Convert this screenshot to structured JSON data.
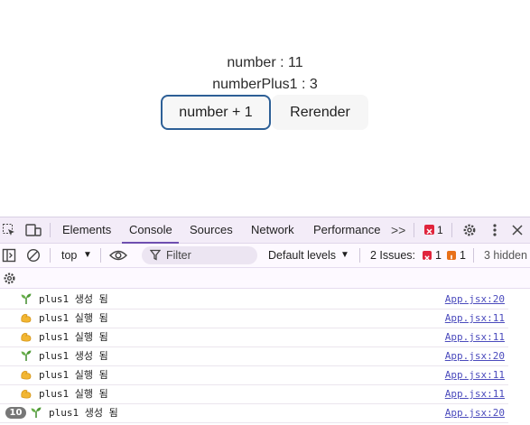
{
  "app": {
    "number_text": "number : 11",
    "numberplus1_text": "numberPlus1 : 3",
    "plus_button": "number + 1",
    "rerender_button": "Rerender"
  },
  "devtools": {
    "tabs": [
      "Elements",
      "Console",
      "Sources",
      "Network",
      "Performance"
    ],
    "active_tab": "Console",
    "more_tabs": ">>",
    "error_count": "1",
    "toolbar": {
      "context": "top",
      "filter_placeholder": "Filter",
      "levels": "Default levels",
      "issues_label": "2 Issues:",
      "issues_error_count": "1",
      "issues_warning_count": "1",
      "hidden": "3 hidden"
    },
    "messages": [
      {
        "icon": "seedling-icon",
        "text": "plus1 생성 됨",
        "source": "App.jsx:20"
      },
      {
        "icon": "muscle-icon",
        "text": "plus1 실행 됨",
        "source": "App.jsx:11"
      },
      {
        "icon": "muscle-icon",
        "text": "plus1 실행 됨",
        "source": "App.jsx:11"
      },
      {
        "icon": "seedling-icon",
        "text": "plus1 생성 됨",
        "source": "App.jsx:20"
      },
      {
        "icon": "muscle-icon",
        "text": "plus1 실행 됨",
        "source": "App.jsx:11"
      },
      {
        "icon": "muscle-icon",
        "text": "plus1 실행 됨",
        "source": "App.jsx:11"
      },
      {
        "icon": "seedling-icon",
        "text": "plus1 생성 됨",
        "source": "App.jsx:20",
        "repeat": "10"
      }
    ],
    "colors": {
      "tabbar_bg": "#f3ecf8",
      "active_underline": "#6e4fb0",
      "link": "#4b4bbd",
      "error": "#e0243c",
      "warning": "#e8711a",
      "button_focus_border": "#2d5f96"
    }
  }
}
